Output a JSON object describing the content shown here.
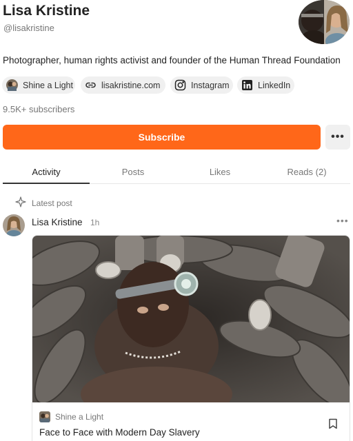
{
  "profile": {
    "name": "Lisa Kristine",
    "handle": "@lisakristine",
    "bio": "Photographer, human rights activist and founder of the Human Thread Foundation",
    "subscribers": "9.5K+ subscribers"
  },
  "links": [
    {
      "label": "Shine a Light",
      "icon": "publication-thumbnail"
    },
    {
      "label": "lisakristine.com",
      "icon": "link-icon"
    },
    {
      "label": "Instagram",
      "icon": "instagram-icon"
    },
    {
      "label": "LinkedIn",
      "icon": "linkedin-icon"
    }
  ],
  "actions": {
    "subscribe_label": "Subscribe",
    "more_label": "•••"
  },
  "tabs": [
    {
      "label": "Activity",
      "active": true
    },
    {
      "label": "Posts",
      "active": false
    },
    {
      "label": "Likes",
      "active": false
    },
    {
      "label": "Reads (2)",
      "active": false
    }
  ],
  "feed": {
    "section_label": "Latest post",
    "section_icon": "sparkle-icon",
    "post": {
      "author": "Lisa Kristine",
      "time": "1h",
      "more_label": "•••",
      "publication": "Shine a Light",
      "title": "Face to Face with Modern Day Slavery"
    }
  },
  "colors": {
    "accent": "#ff6719",
    "chip_bg": "#f0f0f0",
    "muted_text": "#777777"
  }
}
